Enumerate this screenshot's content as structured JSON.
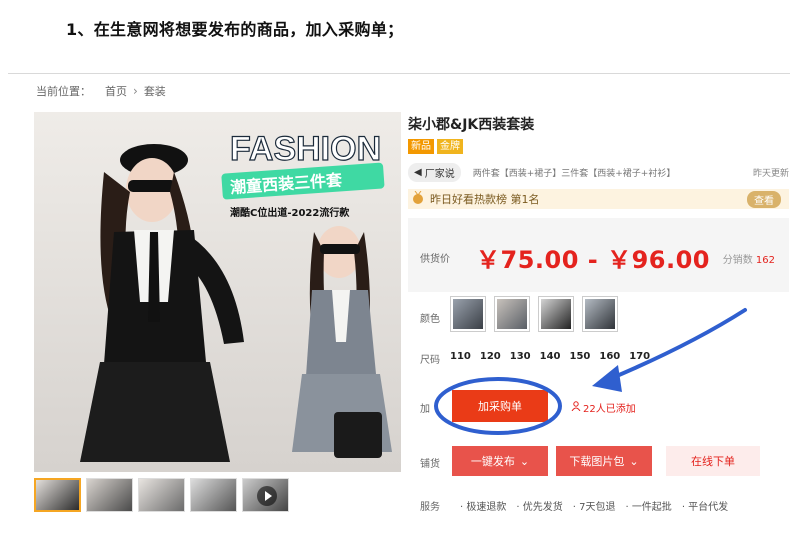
{
  "heading": "1、在生意网将想要发布的商品，加入采购单；",
  "breadcrumb": {
    "label": "当前位置：",
    "home": "首页",
    "current": "套装"
  },
  "image": {
    "fashion_text": "FASHION",
    "banner_text": "潮童西装三件套",
    "caption": "潮酷C位出道-2022流行款"
  },
  "product": {
    "title": "柒小郡&JK西装套装",
    "badges": [
      "新品",
      "金牌"
    ],
    "maker_tag": "厂家说",
    "maker_desc": "两件套【西装+裙子】三件套【西装+裙子+衬衫】",
    "update": "昨天更新",
    "rank_text": "昨日好看热款榜 第1名",
    "rank_button": "查看",
    "price_label": "供货价",
    "price": "￥75.00 - ￥96.00",
    "sold_label": "分销数",
    "sold_count": "162",
    "color_label": "颜色",
    "size_label": "尺码",
    "sizes": [
      "110",
      "120",
      "130",
      "140",
      "150",
      "160",
      "170"
    ],
    "add_label": "加",
    "add_button": "加采购单",
    "added_text": "22人已添加",
    "distribute_label": "铺货",
    "publish_button": "一键发布",
    "download_button": "下载图片包",
    "order_button": "在线下单",
    "service_label": "服务",
    "services": [
      "极速退款",
      "优先发货",
      "7天包退",
      "一件起批",
      "平台代发"
    ]
  },
  "colors": {
    "price_red": "#e4231e",
    "add_button": "#ea3b17",
    "annotation_blue": "#2f5fcf"
  }
}
